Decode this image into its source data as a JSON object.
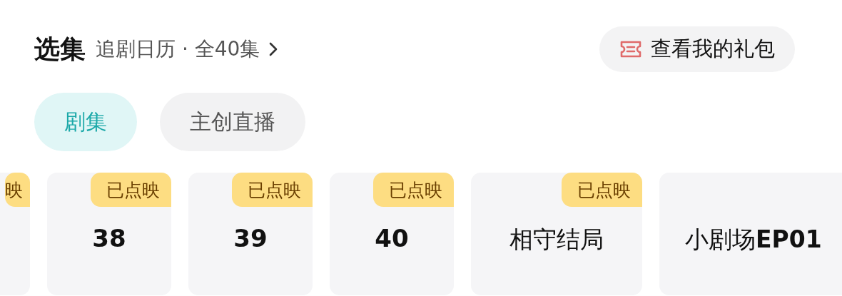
{
  "header": {
    "title": "选集",
    "subtitle": "追剧日历 · 全40集",
    "gift_button": "查看我的礼包"
  },
  "tabs": [
    {
      "label": "剧集",
      "selected": true
    },
    {
      "label": "主创直播",
      "selected": false
    }
  ],
  "episodes": [
    {
      "badge": "映"
    },
    {
      "kind": "number",
      "label": "38",
      "badge": "已点映"
    },
    {
      "kind": "number",
      "label": "39",
      "badge": "已点映"
    },
    {
      "kind": "number",
      "label": "40",
      "badge": "已点映"
    },
    {
      "kind": "title",
      "label": "相守结局",
      "badge": "已点映"
    },
    {
      "kind": "title",
      "label": "小剧场**EP01**"
    }
  ]
}
